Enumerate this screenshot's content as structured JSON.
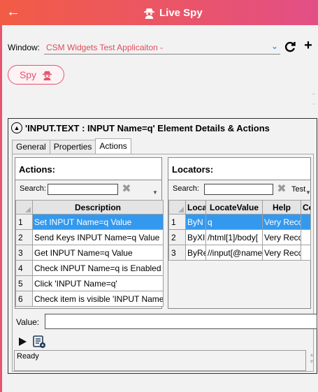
{
  "app": {
    "title": "Live Spy"
  },
  "window_selector": {
    "label": "Window:",
    "value": "CSM Widgets Test Applicaiton -"
  },
  "spy_button": {
    "label": "Spy"
  },
  "details": {
    "title": "'INPUT.TEXT : INPUT Name=q' Element Details & Actions",
    "tabs": [
      {
        "label": "General",
        "active": false
      },
      {
        "label": "Properties",
        "active": false
      },
      {
        "label": "Actions",
        "active": true
      }
    ]
  },
  "actions_pane": {
    "heading": "Actions:",
    "search_label": "Search:",
    "search_value": "",
    "columns": [
      "Description"
    ],
    "rows": [
      {
        "n": "1",
        "description": "Set INPUT Name=q Value",
        "selected": true
      },
      {
        "n": "2",
        "description": "Send Keys INPUT Name=q Value",
        "selected": false
      },
      {
        "n": "3",
        "description": "Get INPUT Name=q Value",
        "selected": false
      },
      {
        "n": "4",
        "description": "Check INPUT Name=q is Enabled",
        "selected": false
      },
      {
        "n": "5",
        "description": "Click 'INPUT Name=q'",
        "selected": false
      },
      {
        "n": "6",
        "description": "Check item is visible 'INPUT Name",
        "selected": false
      }
    ]
  },
  "locators_pane": {
    "heading": "Locators:",
    "search_label": "Search:",
    "search_value": "",
    "test_label": "Test",
    "columns": [
      "Loca",
      "LocateValue",
      "Help",
      "Coun"
    ],
    "rows": [
      {
        "n": "1",
        "cells": [
          "ByN",
          "q",
          "Very Reco",
          ""
        ],
        "selected": true
      },
      {
        "n": "2",
        "cells": [
          "ByXI",
          "/html[1]/body[",
          "Very Reco",
          ""
        ],
        "selected": false
      },
      {
        "n": "3",
        "cells": [
          "ByRe",
          "//input[@name",
          "Very Reco",
          ""
        ],
        "selected": false
      }
    ]
  },
  "value_field": {
    "label": "Value:",
    "value": ""
  },
  "status": {
    "text": "Ready"
  },
  "colors": {
    "accent": "#e55570",
    "selection": "#3399ef",
    "window_name": "#e04c58"
  }
}
